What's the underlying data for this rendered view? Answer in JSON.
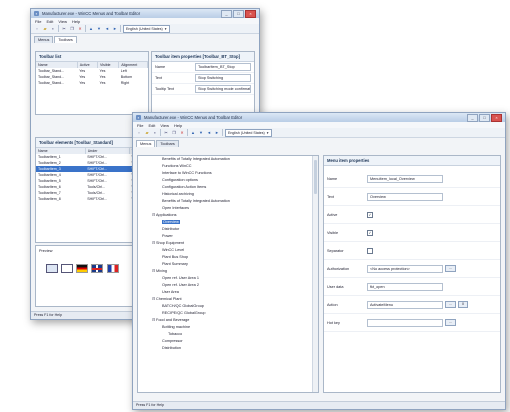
{
  "back_window": {
    "title": "Manufacturer.exe - WinCC Menus and Toolbar Editor",
    "menu": [
      "File",
      "Edit",
      "View",
      "Help"
    ],
    "toolbar_select": "English (United States)",
    "tabs": [
      "Menus",
      "Toolbars"
    ],
    "toolbar_list": {
      "title": "Toolbar list",
      "headers": [
        "Name",
        "Active",
        "Visible",
        "Alignment"
      ],
      "rows": [
        [
          "Toolbar_Stand...",
          "Yes",
          "Yes",
          "Left"
        ],
        [
          "Toolbar_Stand...",
          "Yes",
          "Yes",
          "Bottom"
        ],
        [
          "Toolbar_Stand...",
          "Yes",
          "Yes",
          "Right"
        ]
      ]
    },
    "toolbar_elements": {
      "title": "Toolbar elements [Toolbar_Standard]",
      "headers": [
        "Name",
        "Under",
        "Vis"
      ],
      "rows": [
        [
          "ToolbarItem_1",
          "SHIFT/Ctrl...",
          "Ye"
        ],
        [
          "ToolbarItem_2",
          "SHIFT/Ctrl...",
          "Ye"
        ],
        [
          "ToolbarItem_3",
          "SHIFT/Ctrl...",
          "Ye"
        ],
        [
          "ToolbarItem_4",
          "SHIFT/Ctrl...",
          "Ye"
        ],
        [
          "ToolbarItem_5",
          "SHIFT/Ctrl...",
          "Ye"
        ],
        [
          "ToolbarItem_6",
          "Tools/Ctrl...",
          "Ye"
        ],
        [
          "ToolbarItem_7",
          "Tools/Ctrl...",
          "Ye"
        ],
        [
          "ToolbarItem_8",
          "SHIFT/Ctrl...",
          "Ye"
        ]
      ],
      "selected_index": 2
    },
    "preview_label": "Preview",
    "item_properties": {
      "title": "Toolbar item properties [Toolbar_BT_Stop]",
      "rows": [
        {
          "label": "Name",
          "value": "ToolbarItem_BT_Stop"
        },
        {
          "label": "Text",
          "value": "Stop Switching"
        },
        {
          "label": "Tooltip Text",
          "value": "Stop Switching mode confirmation"
        }
      ]
    },
    "status": "Press F1 for Help"
  },
  "front_window": {
    "title": "Manufacturer.exe - WinCC Menus and Toolbar Editor",
    "menu": [
      "File",
      "Edit",
      "View",
      "Help"
    ],
    "toolbar_select": "English (United States)",
    "tabs": [
      "Menus",
      "Toolbars"
    ],
    "tree": [
      {
        "label": "Benefits of Totally Integrated Automation",
        "indent": 2
      },
      {
        "label": "Functions WinCC",
        "indent": 2
      },
      {
        "label": "Interface to WinCC Functions",
        "indent": 2
      },
      {
        "label": "Configuration options",
        "indent": 2
      },
      {
        "label": "Configuration Action Items",
        "indent": 2
      },
      {
        "label": "Historical archiving",
        "indent": 2
      },
      {
        "label": "Benefits of Totally Integrated Automation",
        "indent": 2
      },
      {
        "label": "Open Interfaces",
        "indent": 2
      },
      {
        "label": "Applications",
        "indent": 1,
        "exp": "−"
      },
      {
        "label": "Overview",
        "indent": 2,
        "selected": true
      },
      {
        "label": "Distributor",
        "indent": 2
      },
      {
        "label": "Power",
        "indent": 2
      },
      {
        "label": "Shop Equipment",
        "indent": 1,
        "exp": "−"
      },
      {
        "label": "WinCC Level",
        "indent": 2
      },
      {
        "label": "Plant Bus Shop",
        "indent": 2
      },
      {
        "label": "Plant Summary",
        "indent": 2
      },
      {
        "label": "Mixing",
        "indent": 1,
        "exp": "−"
      },
      {
        "label": "Open ref. User Area 1",
        "indent": 2
      },
      {
        "label": "Open ref. User Area 2",
        "indent": 2
      },
      {
        "label": "User Area",
        "indent": 2
      },
      {
        "label": "Chemical Plant",
        "indent": 1,
        "exp": "−"
      },
      {
        "label": "BATCH/QC GlobalGroup",
        "indent": 2
      },
      {
        "label": "RECIPE/QC GlobalGroup",
        "indent": 2
      },
      {
        "label": "Food and Beverage",
        "indent": 1,
        "exp": "−"
      },
      {
        "label": "Bottling machine",
        "indent": 2
      },
      {
        "label": "Tobacco",
        "indent": 3
      },
      {
        "label": "Compressor",
        "indent": 2
      },
      {
        "label": "Distribution",
        "indent": 2
      }
    ],
    "menu_item_properties": {
      "title": "Menu item properties",
      "rows": [
        {
          "label": "Name",
          "value": "MenuItem_local_Overview",
          "kind": "text"
        },
        {
          "label": "Text",
          "value": "Overview",
          "kind": "text"
        },
        {
          "label": "Active",
          "value": "✓",
          "kind": "check"
        },
        {
          "label": "Visible",
          "value": "✓",
          "kind": "check"
        },
        {
          "label": "Separator",
          "value": "",
          "kind": "check"
        },
        {
          "label": "Authorization",
          "value": "<No access protection>",
          "kind": "select",
          "button": "..."
        },
        {
          "label": "User data",
          "value": "fkt_open",
          "kind": "text"
        },
        {
          "label": "Action",
          "value": "ActivateMenu",
          "kind": "select",
          "button": "...",
          "button2": "X"
        },
        {
          "label": "Hot key",
          "value": "",
          "kind": "text",
          "button": "..."
        }
      ]
    },
    "status": "Press F1 for Help"
  }
}
